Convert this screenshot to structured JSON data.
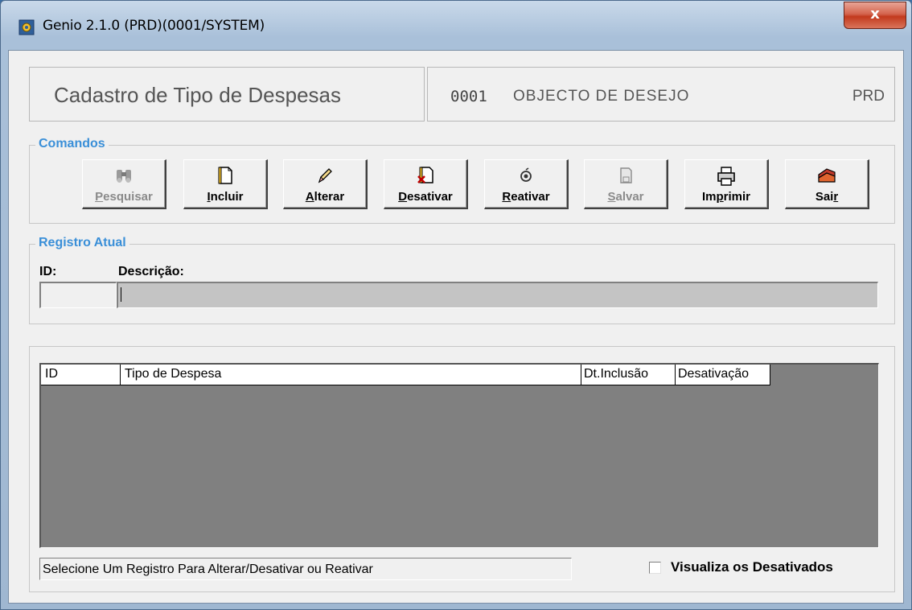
{
  "window": {
    "title": "Genio 2.1.0 (PRD)(0001/SYSTEM)",
    "close_label": "x"
  },
  "header": {
    "screen_title": "Cadastro de Tipo de Despesas",
    "company_code": "0001",
    "company_name": "OBJECTO DE DESEJO",
    "environment": "PRD"
  },
  "commands": {
    "legend": "Comandos",
    "buttons": [
      {
        "label": "Pesquisar",
        "mnemonic": "P",
        "rest": "esquisar",
        "icon": "binoculars-icon",
        "enabled": false
      },
      {
        "label": "Incluir",
        "mnemonic": "I",
        "rest": "ncluir",
        "icon": "new-document-icon",
        "enabled": true
      },
      {
        "label": "Alterar",
        "mnemonic": "A",
        "rest": "lterar",
        "icon": "pencil-icon",
        "enabled": true
      },
      {
        "label": "Desativar",
        "mnemonic": "D",
        "rest": "esativar",
        "icon": "delete-document-icon",
        "enabled": true
      },
      {
        "label": "Reativar",
        "mnemonic": "R",
        "rest": "eativar",
        "icon": "reactivate-icon",
        "enabled": true
      },
      {
        "label": "Salvar",
        "mnemonic": "S",
        "rest": "alvar",
        "icon": "save-disk-icon",
        "enabled": false
      },
      {
        "label": "Imprimir",
        "pre": "Im",
        "mnemonic": "p",
        "rest": "rimir",
        "icon": "printer-icon",
        "enabled": true
      },
      {
        "label": "Sair",
        "pre": "Sai",
        "mnemonic": "r",
        "rest": "",
        "icon": "exit-door-icon",
        "enabled": true
      }
    ]
  },
  "current_record": {
    "legend": "Registro Atual",
    "id_label": "ID:",
    "description_label": "Descrição:",
    "id_value": "",
    "description_value": ""
  },
  "grid": {
    "columns": [
      "ID",
      "Tipo de Despesa",
      "Dt.Inclusão",
      "Desativação"
    ],
    "rows": []
  },
  "footer": {
    "status_text": "Selecione Um Registro Para Alterar/Desativar ou Reativar",
    "show_inactive_label": "Visualiza os Desativados",
    "show_inactive_checked": false
  },
  "colors": {
    "legend": "#3a8fd8",
    "grid_background": "#808080",
    "close_button": "#c2391d"
  }
}
